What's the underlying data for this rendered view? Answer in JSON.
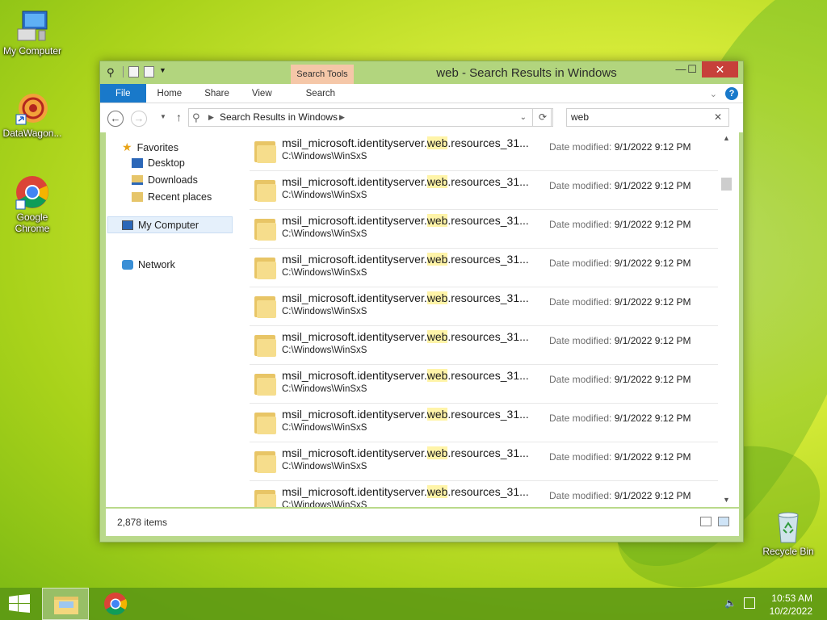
{
  "desktop": {
    "icons": [
      {
        "label": "My Computer"
      },
      {
        "label": "DataWagon..."
      },
      {
        "label": "Google Chrome"
      },
      {
        "label": "Recycle Bin"
      }
    ]
  },
  "window": {
    "title": "web - Search Results in Windows",
    "context_tab_group": "Search Tools",
    "tabs": [
      "File",
      "Home",
      "Share",
      "View",
      "Search"
    ],
    "controls": {
      "minimize": "—",
      "maximize": "☐",
      "close": "✕"
    },
    "address": {
      "crumb": "Search Results in Windows"
    },
    "search": {
      "value": "web"
    },
    "nav_pane": {
      "favorites": "Favorites",
      "desktop": "Desktop",
      "downloads": "Downloads",
      "recent": "Recent places",
      "my_computer": "My Computer",
      "network": "Network"
    },
    "results": [
      {
        "prefix": "msil_microsoft.identityserver.",
        "match": "web",
        "suffix": ".resources_31...",
        "path": "C:\\Windows\\WinSxS",
        "date_label": "Date modified:",
        "date": "9/1/2022 9:12 PM"
      },
      {
        "prefix": "msil_microsoft.identityserver.",
        "match": "web",
        "suffix": ".resources_31...",
        "path": "C:\\Windows\\WinSxS",
        "date_label": "Date modified:",
        "date": "9/1/2022 9:12 PM"
      },
      {
        "prefix": "msil_microsoft.identityserver.",
        "match": "web",
        "suffix": ".resources_31...",
        "path": "C:\\Windows\\WinSxS",
        "date_label": "Date modified:",
        "date": "9/1/2022 9:12 PM"
      },
      {
        "prefix": "msil_microsoft.identityserver.",
        "match": "web",
        "suffix": ".resources_31...",
        "path": "C:\\Windows\\WinSxS",
        "date_label": "Date modified:",
        "date": "9/1/2022 9:12 PM"
      },
      {
        "prefix": "msil_microsoft.identityserver.",
        "match": "web",
        "suffix": ".resources_31...",
        "path": "C:\\Windows\\WinSxS",
        "date_label": "Date modified:",
        "date": "9/1/2022 9:12 PM"
      },
      {
        "prefix": "msil_microsoft.identityserver.",
        "match": "web",
        "suffix": ".resources_31...",
        "path": "C:\\Windows\\WinSxS",
        "date_label": "Date modified:",
        "date": "9/1/2022 9:12 PM"
      },
      {
        "prefix": "msil_microsoft.identityserver.",
        "match": "web",
        "suffix": ".resources_31...",
        "path": "C:\\Windows\\WinSxS",
        "date_label": "Date modified:",
        "date": "9/1/2022 9:12 PM"
      },
      {
        "prefix": "msil_microsoft.identityserver.",
        "match": "web",
        "suffix": ".resources_31...",
        "path": "C:\\Windows\\WinSxS",
        "date_label": "Date modified:",
        "date": "9/1/2022 9:12 PM"
      },
      {
        "prefix": "msil_microsoft.identityserver.",
        "match": "web",
        "suffix": ".resources_31...",
        "path": "C:\\Windows\\WinSxS",
        "date_label": "Date modified:",
        "date": "9/1/2022 9:12 PM"
      },
      {
        "prefix": "msil_microsoft.identityserver.",
        "match": "web",
        "suffix": ".resources_31...",
        "path": "C:\\Windows\\WinSxS",
        "date_label": "Date modified:",
        "date": "9/1/2022 9:12 PM"
      }
    ],
    "status": {
      "item_count": "2,878 items"
    }
  },
  "taskbar": {
    "time": "10:53 AM",
    "date": "10/2/2022"
  }
}
